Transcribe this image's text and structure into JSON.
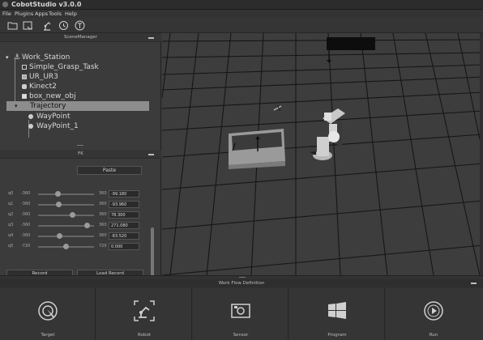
{
  "window": {
    "title": "CobotStudio v3.0.0"
  },
  "menu": [
    "File",
    "Plugins",
    "Apps",
    "Tools",
    "Help"
  ],
  "toolbar": {
    "icons": [
      "open-folder-icon",
      "save-icon",
      "robot-arm-icon",
      "rotate-icon",
      "text-tool-icon"
    ]
  },
  "scene_manager": {
    "title": "SceneManager",
    "tree": [
      {
        "label": "Work_Station",
        "icon": "anchor-icon",
        "depth": 0,
        "expanded": true
      },
      {
        "label": "Simple_Grasp_Task",
        "icon": "doc-icon",
        "depth": 1
      },
      {
        "label": "UR_UR3",
        "icon": "robot-icon",
        "depth": 1
      },
      {
        "label": "Kinect2",
        "icon": "camera-icon",
        "depth": 1
      },
      {
        "label": "box_new_obj",
        "icon": "box-icon",
        "depth": 1
      },
      {
        "label": "Trajectory",
        "icon": "",
        "depth": 1,
        "selected": true,
        "expanded": true
      },
      {
        "label": "WayPoint",
        "icon": "waypoint-icon",
        "depth": 2
      },
      {
        "label": "WayPoint_1",
        "icon": "waypoint-icon",
        "depth": 2
      }
    ]
  },
  "fk": {
    "title": "FK",
    "paste_label": "Paste",
    "joints": [
      {
        "name": "q0",
        "min": "-360",
        "max": "360",
        "value": "-99.180",
        "level": 0.36
      },
      {
        "name": "q1",
        "min": "-360",
        "max": "360",
        "value": "-93.960",
        "level": 0.37
      },
      {
        "name": "q2",
        "min": "-360",
        "max": "360",
        "value": "78.300",
        "level": 0.61
      },
      {
        "name": "q3",
        "min": "-360",
        "max": "360",
        "value": "271.080",
        "level": 0.88
      },
      {
        "name": "q4",
        "min": "-360",
        "max": "360",
        "value": "-83.520",
        "level": 0.38
      },
      {
        "name": "q5",
        "min": "-720",
        "max": "720",
        "value": "0.000",
        "level": 0.5
      }
    ],
    "record_label": "Record",
    "load_record_label": "Load Record"
  },
  "workflow": {
    "title": "Work Flow Definition",
    "items": [
      {
        "label": "Target",
        "icon": "target-icon"
      },
      {
        "label": "Robot",
        "icon": "robot-arm-icon"
      },
      {
        "label": "Sensor",
        "icon": "sensor-icon"
      },
      {
        "label": "Program",
        "icon": "windows-icon"
      },
      {
        "label": "Run",
        "icon": "play-icon"
      }
    ]
  }
}
